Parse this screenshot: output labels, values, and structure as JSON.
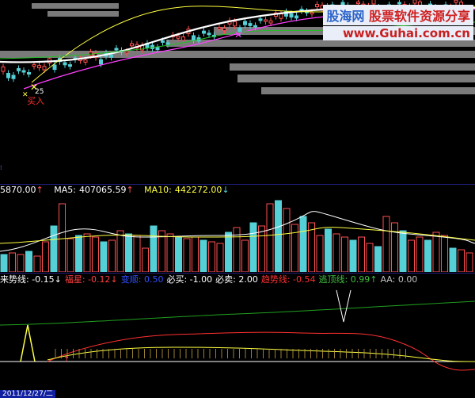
{
  "main_chart": {
    "buy_marker": "25",
    "buy_label": "买入"
  },
  "volume_info": {
    "vol": "5870.00",
    "ma5_label": "MA5:",
    "ma5_value": "407065.59",
    "ma10_label": "MA10:",
    "ma10_value": "442272.00",
    "arrow_up": "↑",
    "arrow_down": "↓"
  },
  "indicator_info": {
    "items": [
      {
        "label": "来势线:",
        "value": "-0.15",
        "arrow": "↓",
        "color": "#ffffff"
      },
      {
        "label": "福星:",
        "value": "-0.12",
        "arrow": "↓",
        "color": "#ff4040"
      },
      {
        "label": "变顺:",
        "value": "0.50",
        "arrow": "",
        "color": "#3050ff"
      },
      {
        "label": "必买:",
        "value": "-1.00",
        "arrow": "",
        "color": "#ffffff"
      },
      {
        "label": "必卖:",
        "value": "2.00",
        "arrow": "",
        "color": "#ffffff"
      },
      {
        "label": "趋势线:",
        "value": "-0.54",
        "arrow": "",
        "color": "#ff3030"
      },
      {
        "label": "逃顶线:",
        "value": "0.99",
        "arrow": "↑",
        "color": "#40c040"
      },
      {
        "label": "AA:",
        "value": "0.00",
        "arrow": "",
        "color": "#c0c0c0"
      }
    ]
  },
  "watermark": {
    "brand": "股海网",
    "slogan": "股票软件资源分享",
    "url": "www.Guhai.com.cn"
  },
  "date_label": "2011/12/27/二",
  "colors": {
    "up": "#ff5050",
    "down": "#54d0d6",
    "ma_white": "#ffffff",
    "ma_yellow": "#ffff40",
    "ma_magenta": "#ff40ff",
    "ma_green": "#20c020"
  }
}
